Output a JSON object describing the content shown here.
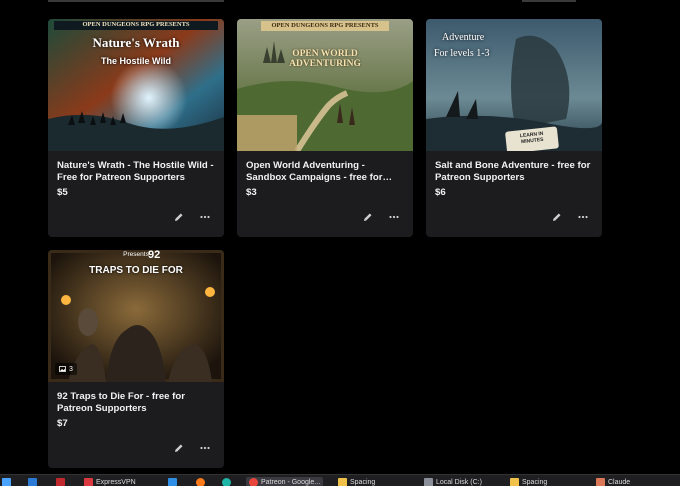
{
  "cards": [
    {
      "title": "Nature's Wrath - The Hostile Wild - Free for Patreon Supporters",
      "price": "$5",
      "thumb": {
        "banner": "OPEN DUNGEONS RPG PRESENTS",
        "heading": "Nature's Wrath",
        "subheading": "The Hostile Wild"
      }
    },
    {
      "title": "Open World Adventuring - Sandbox Campaigns - free for Patreon…",
      "price": "$3",
      "thumb": {
        "banner": "OPEN DUNGEONS RPG PRESENTS",
        "heading": "OPEN WORLD ADVENTURING"
      }
    },
    {
      "title": "Salt and Bone Adventure - free for Patreon Supporters",
      "price": "$6",
      "thumb": {
        "heading": "Adventure",
        "subheading": "For levels 1-3",
        "stamp": "LEARN IN MINUTES"
      }
    },
    {
      "title": "92 Traps to Die For - free for Patreon Supporters",
      "price": "$7",
      "badge_count": "3",
      "thumb": {
        "banner": "Presents",
        "heading": "92",
        "subheading": "TRAPS TO DIE FOR"
      }
    }
  ],
  "taskbar": {
    "items": [
      {
        "label": "ExpressVPN"
      },
      {
        "label": "Patreon - Google..."
      },
      {
        "label": "Spacing"
      },
      {
        "label": "Local Disk (C:)"
      },
      {
        "label": "Spacing"
      },
      {
        "label": "Claude"
      }
    ]
  },
  "colors": {
    "card_bg": "#1c1c1e",
    "page_bg": "#000000",
    "taskbar_bg": "#1f1f22"
  }
}
